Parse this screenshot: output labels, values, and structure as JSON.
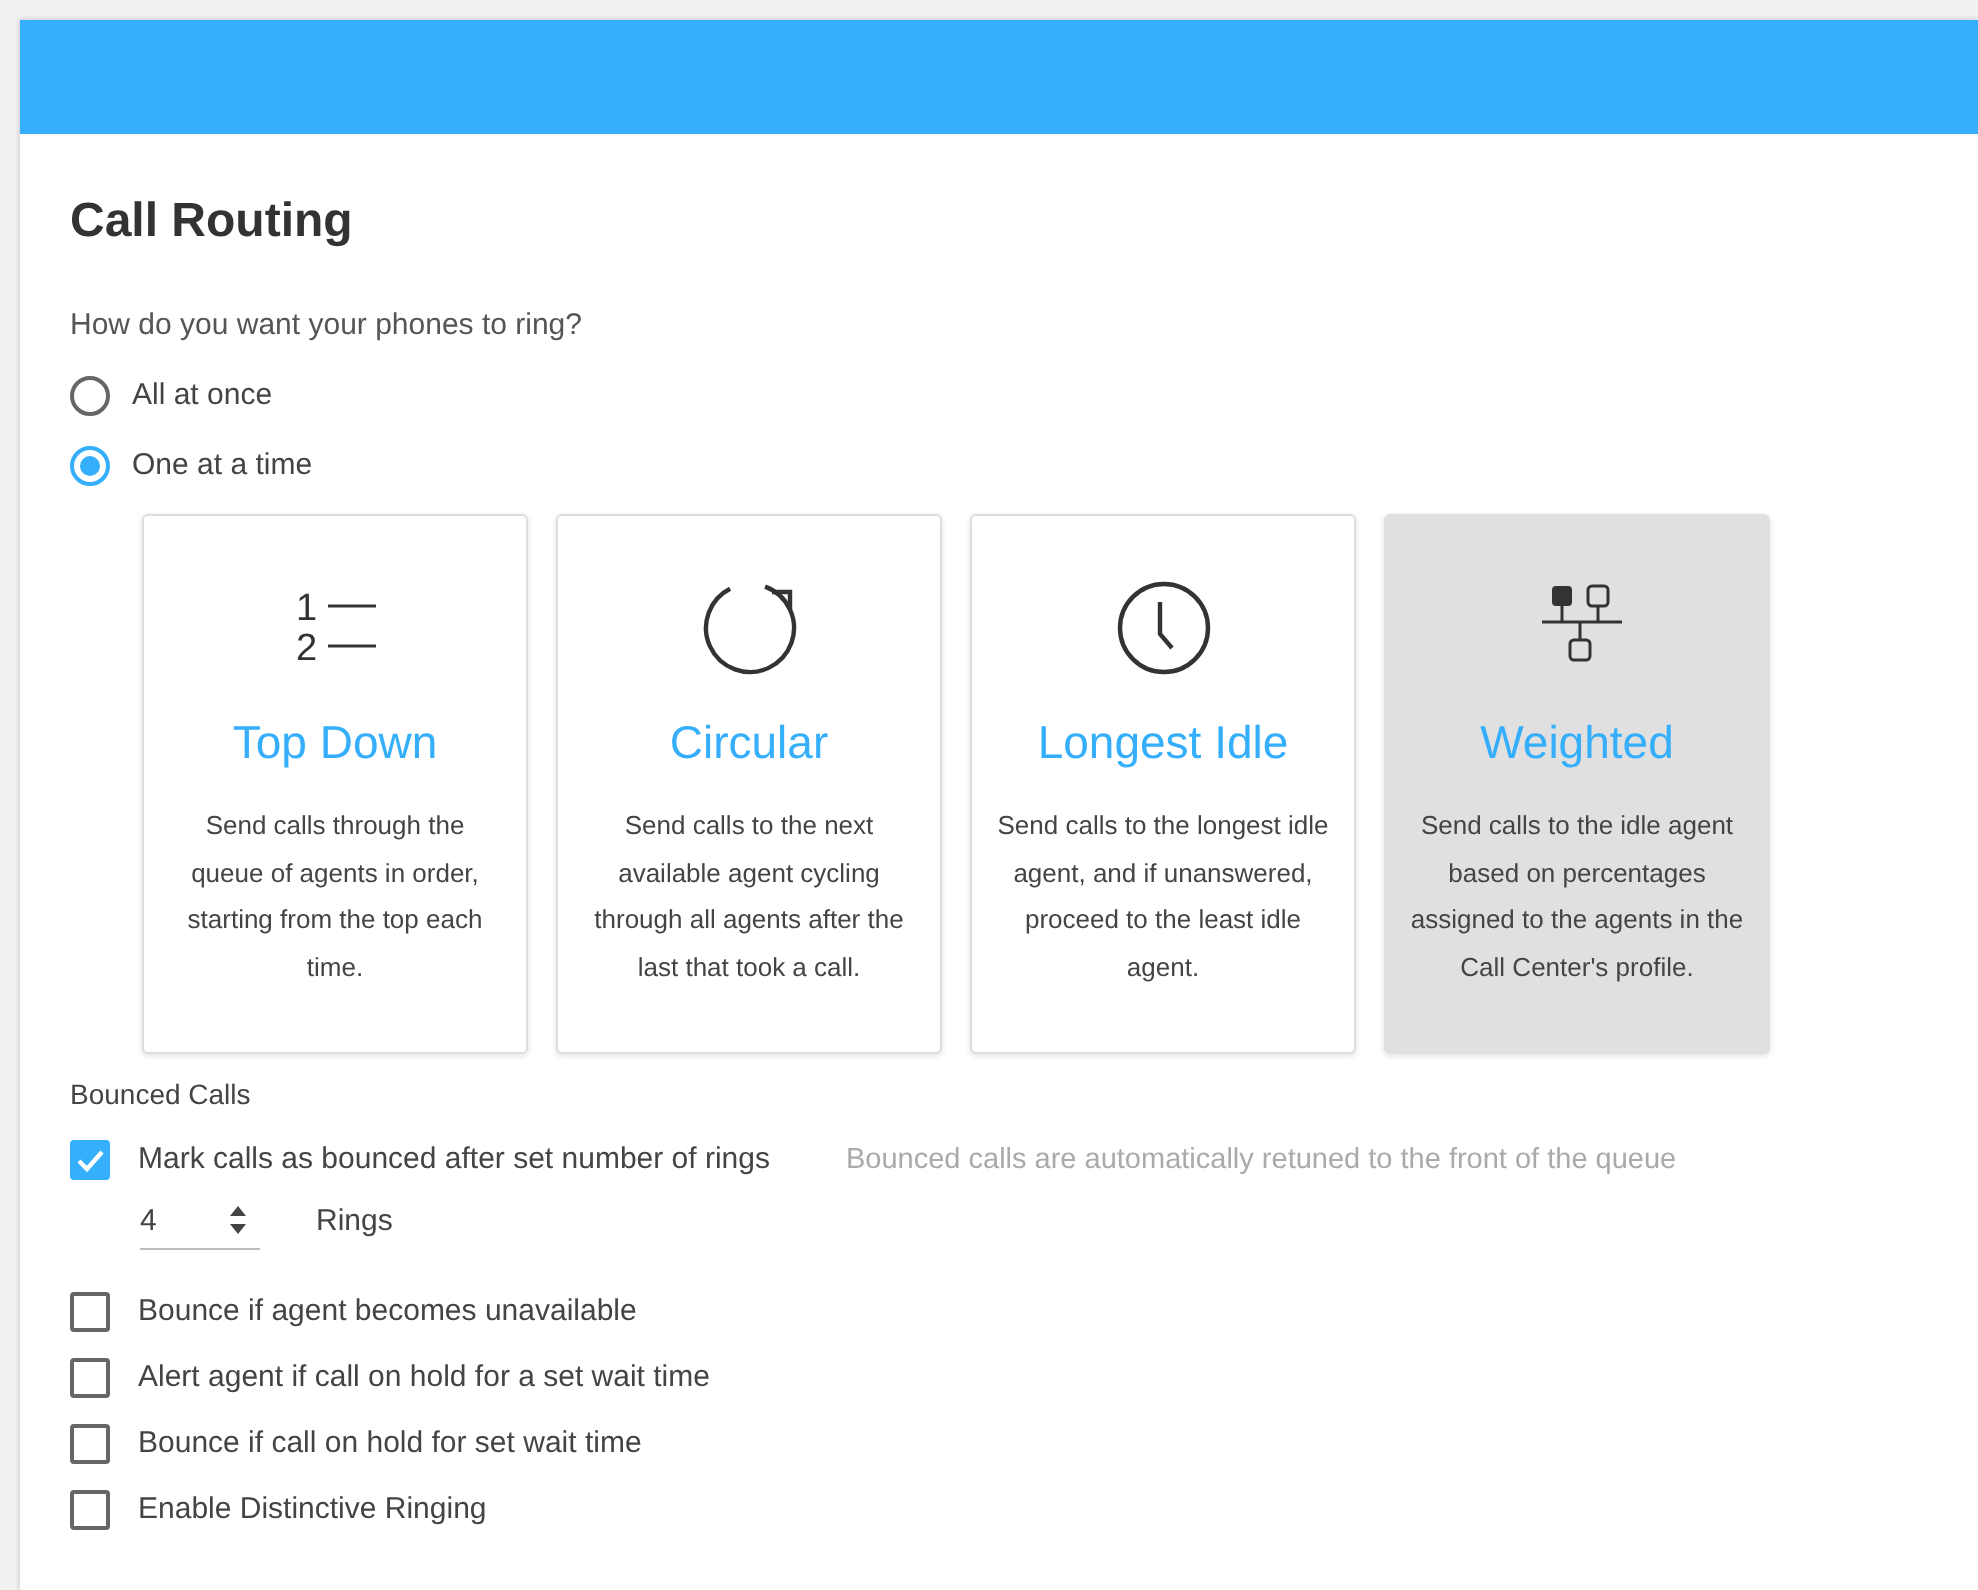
{
  "title": "Call Routing",
  "ring_question": "How do you want your phones to ring?",
  "ring_options": [
    {
      "label": "All at once",
      "selected": false
    },
    {
      "label": "One at a time",
      "selected": true
    }
  ],
  "strategies": [
    {
      "kind": "numbered",
      "icon_text": [
        "1",
        "2"
      ],
      "title": "Top Down",
      "description": "Send calls through the queue of agents in order, starting from the top each time.",
      "selected": false
    },
    {
      "kind": "circular",
      "title": "Circular",
      "description": "Send calls to the next available agent cycling through all agents after the last that took a call.",
      "selected": false
    },
    {
      "kind": "clock",
      "title": "Longest Idle",
      "description": "Send calls to the longest idle agent, and if unanswered, proceed to the least idle agent.",
      "selected": false
    },
    {
      "kind": "tree",
      "title": "Weighted",
      "description": "Send calls to the idle agent based on percentages assigned to the agents in the Call Center's profile.",
      "selected": true
    }
  ],
  "bounced": {
    "heading": "Bounced Calls",
    "mark_option": {
      "label": "Mark calls as bounced after set number of rings",
      "checked": true
    },
    "hint": "Bounced calls are automatically retuned to the front of the queue",
    "rings": {
      "value": "4",
      "unit": "Rings"
    },
    "options": [
      {
        "label": "Bounce if agent becomes unavailable",
        "checked": false
      },
      {
        "label": "Alert agent if call on hold for a set wait time",
        "checked": false
      },
      {
        "label": "Bounce if call on hold for set wait time",
        "checked": false
      },
      {
        "label": "Enable Distinctive Ringing",
        "checked": false
      }
    ]
  }
}
